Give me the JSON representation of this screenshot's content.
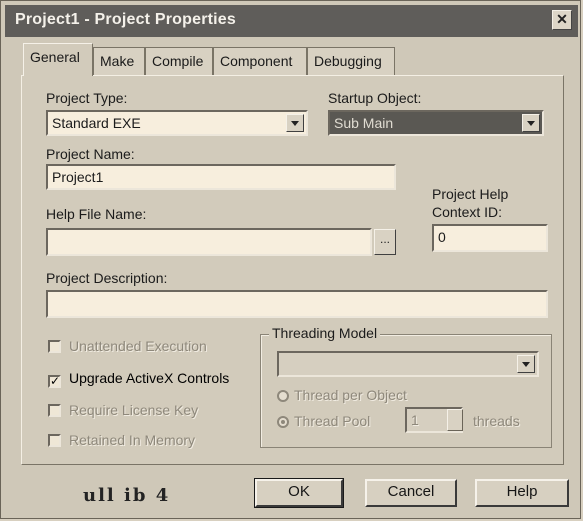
{
  "window": {
    "title": "Project1 - Project Properties"
  },
  "tabs": [
    {
      "label": "General"
    },
    {
      "label": "Make"
    },
    {
      "label": "Compile"
    },
    {
      "label": "Component"
    },
    {
      "label": "Debugging"
    }
  ],
  "general": {
    "project_type_label": "Project Type:",
    "project_type_value": "Standard EXE",
    "startup_object_label": "Startup Object:",
    "startup_object_value": "Sub Main",
    "project_name_label": "Project Name:",
    "project_name_value": "Project1",
    "help_file_label": "Help File Name:",
    "help_file_value": "",
    "help_file_browse": "...",
    "help_context_label_1": "Project Help",
    "help_context_label_2": "Context ID:",
    "help_context_value": "0",
    "description_label": "Project Description:",
    "description_value": "",
    "options": [
      {
        "label": "Unattended Execution",
        "checked": false,
        "enabled": false
      },
      {
        "label": "Upgrade ActiveX Controls",
        "checked": true,
        "enabled": true
      },
      {
        "label": "Require License Key",
        "checked": false,
        "enabled": false
      },
      {
        "label": "Retained In Memory",
        "checked": false,
        "enabled": false
      }
    ],
    "threading": {
      "group_label": "Threading Model",
      "model_value": "",
      "per_object_label": "Thread per Object",
      "pool_label": "Thread Pool",
      "pool_value": "1",
      "threads_label": "threads"
    }
  },
  "footer": {
    "logo_text": "ull ib 4",
    "ok_label": "OK",
    "cancel_label": "Cancel",
    "help_label": "Help"
  },
  "colors": {
    "titlebar": "#5f5d5a",
    "field_bg": "#f7eedd",
    "dialog_bg": "#d2cbbb"
  }
}
